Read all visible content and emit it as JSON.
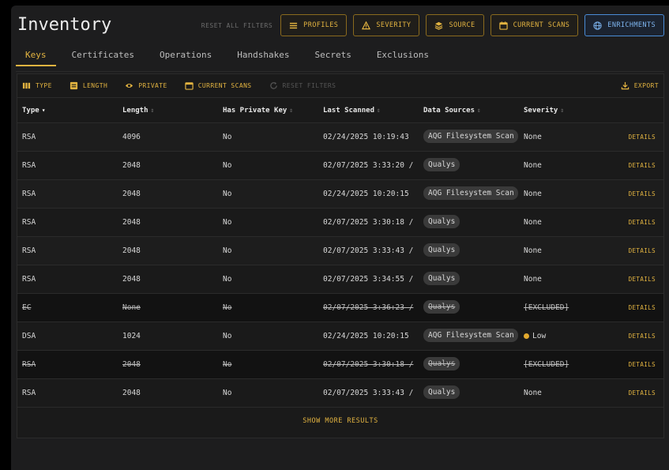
{
  "page": {
    "title": "Inventory"
  },
  "top_actions": {
    "reset_all": "RESET ALL FILTERS",
    "profiles": "PROFILES",
    "severity": "SEVERITY",
    "source": "SOURCE",
    "current_scans": "CURRENT SCANS",
    "enrichments": "ENRICHMENTS"
  },
  "tabs": [
    {
      "label": "Keys",
      "active": true
    },
    {
      "label": "Certificates"
    },
    {
      "label": "Operations"
    },
    {
      "label": "Handshakes"
    },
    {
      "label": "Secrets"
    },
    {
      "label": "Exclusions"
    }
  ],
  "toolbar": {
    "type": "TYPE",
    "length": "LENGTH",
    "private": "PRIVATE",
    "current_scans": "CURRENT SCANS",
    "reset_filters": "RESET FILTERS",
    "export": "EXPORT"
  },
  "columns": [
    "Type",
    "Length",
    "Has Private Key",
    "Last Scanned",
    "Data Sources",
    "Severity"
  ],
  "rows": [
    {
      "type": "RSA",
      "length": "4096",
      "private": "No",
      "scanned": "02/24/2025 10:19:43",
      "source": "AQG Filesystem Scan",
      "severity": "None",
      "action": "DETAILS"
    },
    {
      "type": "RSA",
      "length": "2048",
      "private": "No",
      "scanned": "02/07/2025 3:33:20 /",
      "source": "Qualys",
      "severity": "None",
      "action": "DETAILS"
    },
    {
      "type": "RSA",
      "length": "2048",
      "private": "No",
      "scanned": "02/24/2025 10:20:15",
      "source": "AQG Filesystem Scan",
      "severity": "None",
      "action": "DETAILS"
    },
    {
      "type": "RSA",
      "length": "2048",
      "private": "No",
      "scanned": "02/07/2025 3:30:18 /",
      "source": "Qualys",
      "severity": "None",
      "action": "DETAILS"
    },
    {
      "type": "RSA",
      "length": "2048",
      "private": "No",
      "scanned": "02/07/2025 3:33:43 /",
      "source": "Qualys",
      "severity": "None",
      "action": "DETAILS"
    },
    {
      "type": "RSA",
      "length": "2048",
      "private": "No",
      "scanned": "02/07/2025 3:34:55 /",
      "source": "Qualys",
      "severity": "None",
      "action": "DETAILS"
    },
    {
      "type": "EC",
      "length": "None",
      "private": "No",
      "scanned": "02/07/2025 3:36:23 /",
      "source": "Qualys",
      "severity": "[EXCLUDED]",
      "action": "DETAILS",
      "excluded": true
    },
    {
      "type": "DSA",
      "length": "1024",
      "private": "No",
      "scanned": "02/24/2025 10:20:15",
      "source": "AQG Filesystem Scan",
      "severity": "Low",
      "action": "DETAILS",
      "severity_dot": "#e2a92e"
    },
    {
      "type": "RSA",
      "length": "2048",
      "private": "No",
      "scanned": "02/07/2025 3:30:18 /",
      "source": "Qualys",
      "severity": "[EXCLUDED]",
      "action": "DETAILS",
      "excluded": true
    },
    {
      "type": "RSA",
      "length": "2048",
      "private": "No",
      "scanned": "02/07/2025 3:33:43 /",
      "source": "Qualys",
      "severity": "None",
      "action": "DETAILS"
    }
  ],
  "show_more": "SHOW MORE RESULTS",
  "colors": {
    "accent": "#e2b340",
    "enrich": "#7db4ee",
    "low": "#e2a92e"
  },
  "sort_column": "Type"
}
